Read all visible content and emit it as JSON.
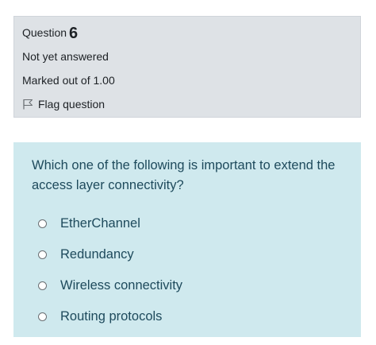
{
  "info": {
    "question_label": "Question",
    "question_number": "6",
    "state": "Not yet answered",
    "grade": "Marked out of 1.00",
    "flag_label": "Flag question",
    "flag_icon": "flag-icon"
  },
  "question": {
    "text": "Which one of the following is important to extend the access layer connectivity?",
    "answers": [
      {
        "label": "EtherChannel",
        "selected": false
      },
      {
        "label": "Redundancy",
        "selected": false
      },
      {
        "label": "Wireless connectivity",
        "selected": false
      },
      {
        "label": "Routing protocols",
        "selected": false
      }
    ]
  },
  "colors": {
    "info_background": "#dee2e6",
    "content_background": "#cfe9ee",
    "question_text": "#1e4a5c"
  }
}
